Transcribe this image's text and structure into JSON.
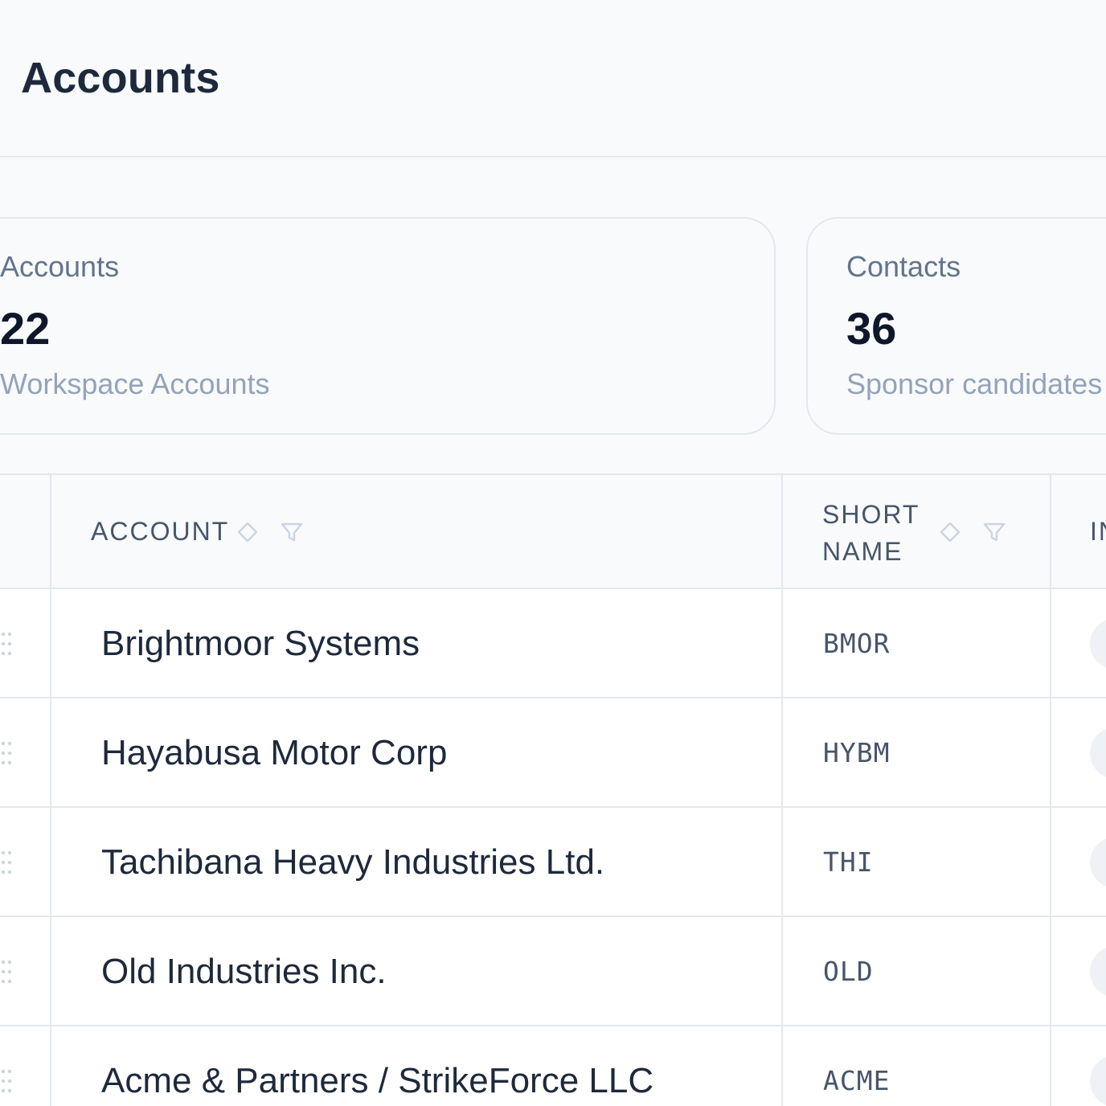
{
  "page": {
    "title": "Accounts"
  },
  "stats": [
    {
      "label": "Accounts",
      "value": "22",
      "sub": "Workspace Accounts"
    },
    {
      "label": "Contacts",
      "value": "36",
      "sub": "Sponsor candidates"
    }
  ],
  "table": {
    "columns": [
      {
        "label": "ACCOUNT",
        "sortable": true,
        "filterable": true
      },
      {
        "label_line1": "SHORT",
        "label_line2": "NAME",
        "sortable": true,
        "filterable": true
      },
      {
        "label": "IN",
        "clipped": true
      }
    ],
    "rows": [
      {
        "account": "Brightmoor Systems",
        "short_name": "BMOR"
      },
      {
        "account": "Hayabusa Motor Corp",
        "short_name": "HYBM"
      },
      {
        "account": "Tachibana Heavy Industries Ltd.",
        "short_name": "THI"
      },
      {
        "account": "Old Industries Inc.",
        "short_name": "OLD"
      },
      {
        "account": "Acme & Partners / StrikeForce LLC",
        "short_name": "ACME"
      }
    ]
  },
  "icons": {
    "sort": "sort-icon",
    "filter": "filter-icon",
    "drag": "drag-handle-icon"
  },
  "colors": {
    "background": "#f8fafc",
    "text_primary": "#1e293b",
    "text_muted": "#64748b",
    "border": "#e3e8ee"
  }
}
